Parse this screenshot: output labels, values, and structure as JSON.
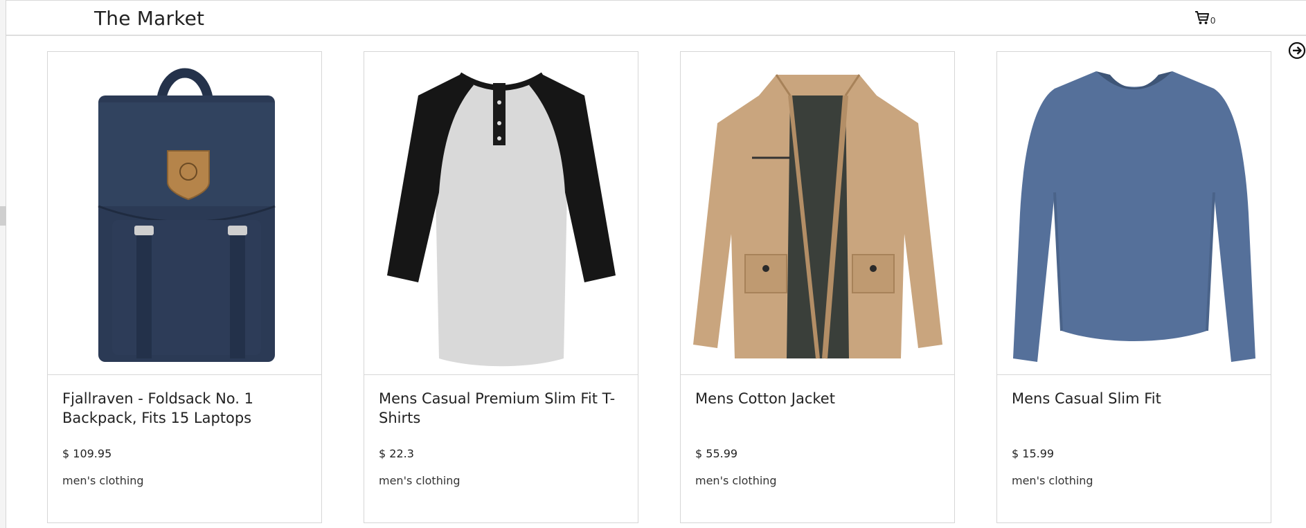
{
  "header": {
    "brand": "The Market",
    "cart_count": "0"
  },
  "icons": {
    "cart": "shopping-cart-icon",
    "next": "arrow-circle-right-icon"
  },
  "products": [
    {
      "title": "Fjallraven - Foldsack No. 1 Backpack, Fits 15 Laptops",
      "price": "$ 109.95",
      "category": "men's clothing",
      "image": "navy-backpack"
    },
    {
      "title": "Mens Casual Premium Slim Fit T-Shirts",
      "price": "$ 22.3",
      "category": "men's clothing",
      "image": "raglan-henley-shirt"
    },
    {
      "title": "Mens Cotton Jacket",
      "price": "$ 55.99",
      "category": "men's clothing",
      "image": "khaki-cotton-jacket"
    },
    {
      "title": "Mens Casual Slim Fit",
      "price": "$ 15.99",
      "category": "men's clothing",
      "image": "blue-long-sleeve-shirt"
    }
  ],
  "colors": {
    "backpack": "#2b3a55",
    "backpack_badge": "#b5844a",
    "shirt_body": "#d9d9d9",
    "shirt_sleeve": "#161616",
    "jacket": "#c9a57e",
    "jacket_lining": "#3a3f3a",
    "longsleeve": "#55709a"
  }
}
